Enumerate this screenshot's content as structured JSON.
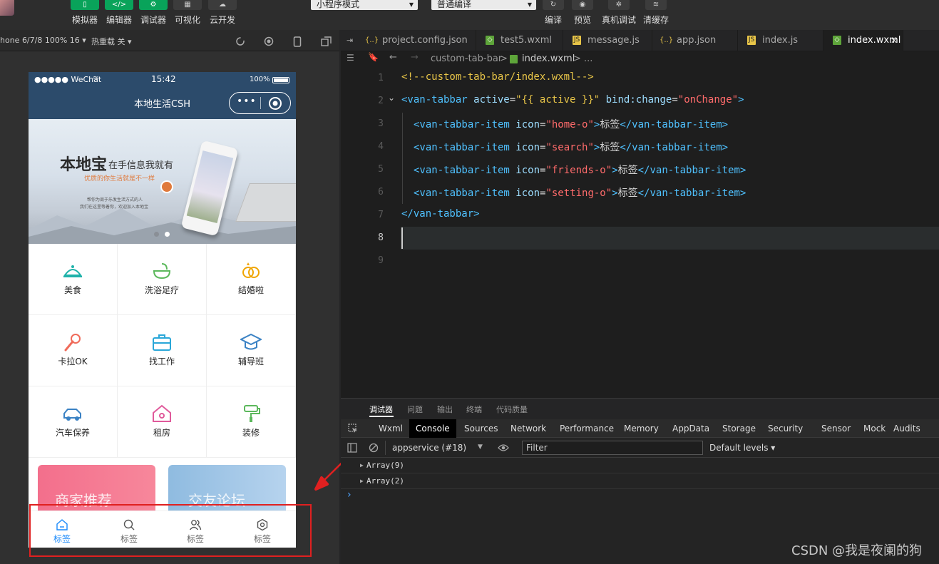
{
  "toolbar": {
    "buttons": [
      {
        "label": "模拟器"
      },
      {
        "label": "编辑器"
      },
      {
        "label": "调试器"
      },
      {
        "label": "可视化"
      },
      {
        "label": "云开发"
      }
    ],
    "mode_select": "小程序模式",
    "compile_select": "普通编译",
    "actions": [
      {
        "label": "编译"
      },
      {
        "label": "预览"
      },
      {
        "label": "真机调试"
      },
      {
        "label": "清缓存"
      }
    ]
  },
  "simulator": {
    "device": "hone 6/7/8 100% 16 ▾",
    "hot_reload": "热重载 关 ▾",
    "status": {
      "carrier": "●●●●● WeChat",
      "time": "15:42",
      "battery": "100%"
    },
    "nav_title": "本地生活CSH",
    "banner": {
      "title": "本地宝",
      "title_suffix": "在手信息我就有",
      "subtitle": "优质的你生活就是不一样",
      "desc1": "帮你为周于乐发生活方式的人",
      "desc2": "我们在这里等着你，欢迎加入本地宝"
    },
    "grid": [
      {
        "label": "美食",
        "icon": "food-icon",
        "color": "#20b2aa"
      },
      {
        "label": "洗浴足疗",
        "icon": "bath-icon",
        "color": "#5cb85c"
      },
      {
        "label": "结婚啦",
        "icon": "rings-icon",
        "color": "#f0a500"
      },
      {
        "label": "卡拉OK",
        "icon": "microphone-icon",
        "color": "#f06b5a"
      },
      {
        "label": "找工作",
        "icon": "briefcase-icon",
        "color": "#2aa7d8"
      },
      {
        "label": "辅导班",
        "icon": "graduation-icon",
        "color": "#3b82c4"
      },
      {
        "label": "汽车保养",
        "icon": "car-icon",
        "color": "#3b82c4"
      },
      {
        "label": "租房",
        "icon": "house-icon",
        "color": "#e05a9b"
      },
      {
        "label": "装修",
        "icon": "paint-roller-icon",
        "color": "#5cb85c"
      }
    ],
    "promo": {
      "left": "商家推荐",
      "right": "交友论坛"
    },
    "tabbar": [
      {
        "label": "标签",
        "icon": "home-icon"
      },
      {
        "label": "标签",
        "icon": "search-icon"
      },
      {
        "label": "标签",
        "icon": "friends-icon"
      },
      {
        "label": "标签",
        "icon": "setting-icon"
      }
    ]
  },
  "editor": {
    "tabs": [
      {
        "label": "project.config.json",
        "type": "json"
      },
      {
        "label": "test5.wxml",
        "type": "wxml"
      },
      {
        "label": "message.js",
        "type": "js"
      },
      {
        "label": "app.json",
        "type": "json"
      },
      {
        "label": "index.js",
        "type": "js"
      },
      {
        "label": "index.wxml",
        "type": "wxml"
      }
    ],
    "close_glyph": "✕",
    "breadcrumb": {
      "folder": "custom-tab-bar",
      "sep": ">",
      "file": "index.wxml",
      "tail": "> ..."
    },
    "lines": {
      "l1": "<!--custom-tab-bar/index.wxml-->",
      "l2_tag": "<van-tabbar",
      "l2_attr1": "active",
      "l2_val1": "\"{{ active }}\"",
      "l2_attr2": "bind:change",
      "l2_val2": "\"onChange\"",
      "l2_end": ">",
      "item_open": "<van-tabbar-item",
      "item_attr": "icon",
      "item_vals": [
        "\"home-o\"",
        "\"search\"",
        "\"friends-o\"",
        "\"setting-o\""
      ],
      "item_text": "标签",
      "item_close": "</van-tabbar-item>",
      "l7": "</van-tabbar>",
      "numbers": [
        "1",
        "2",
        "3",
        "4",
        "5",
        "6",
        "7",
        "8",
        "9"
      ]
    }
  },
  "devtools": {
    "header_tabs": [
      "调试器",
      "问题",
      "输出",
      "终端",
      "代码质量"
    ],
    "panel_tabs": [
      "Wxml",
      "Console",
      "Sources",
      "Network",
      "Performance",
      "Memory",
      "AppData",
      "Storage",
      "Security",
      "Sensor",
      "Mock",
      "Audits"
    ],
    "context": "appservice (#18)",
    "filter_placeholder": "Filter",
    "levels": "Default levels ▾",
    "console_rows": [
      "Array(9)",
      "Array(2)"
    ],
    "prompt": "›"
  },
  "watermark": "CSDN @我是夜阑的狗"
}
